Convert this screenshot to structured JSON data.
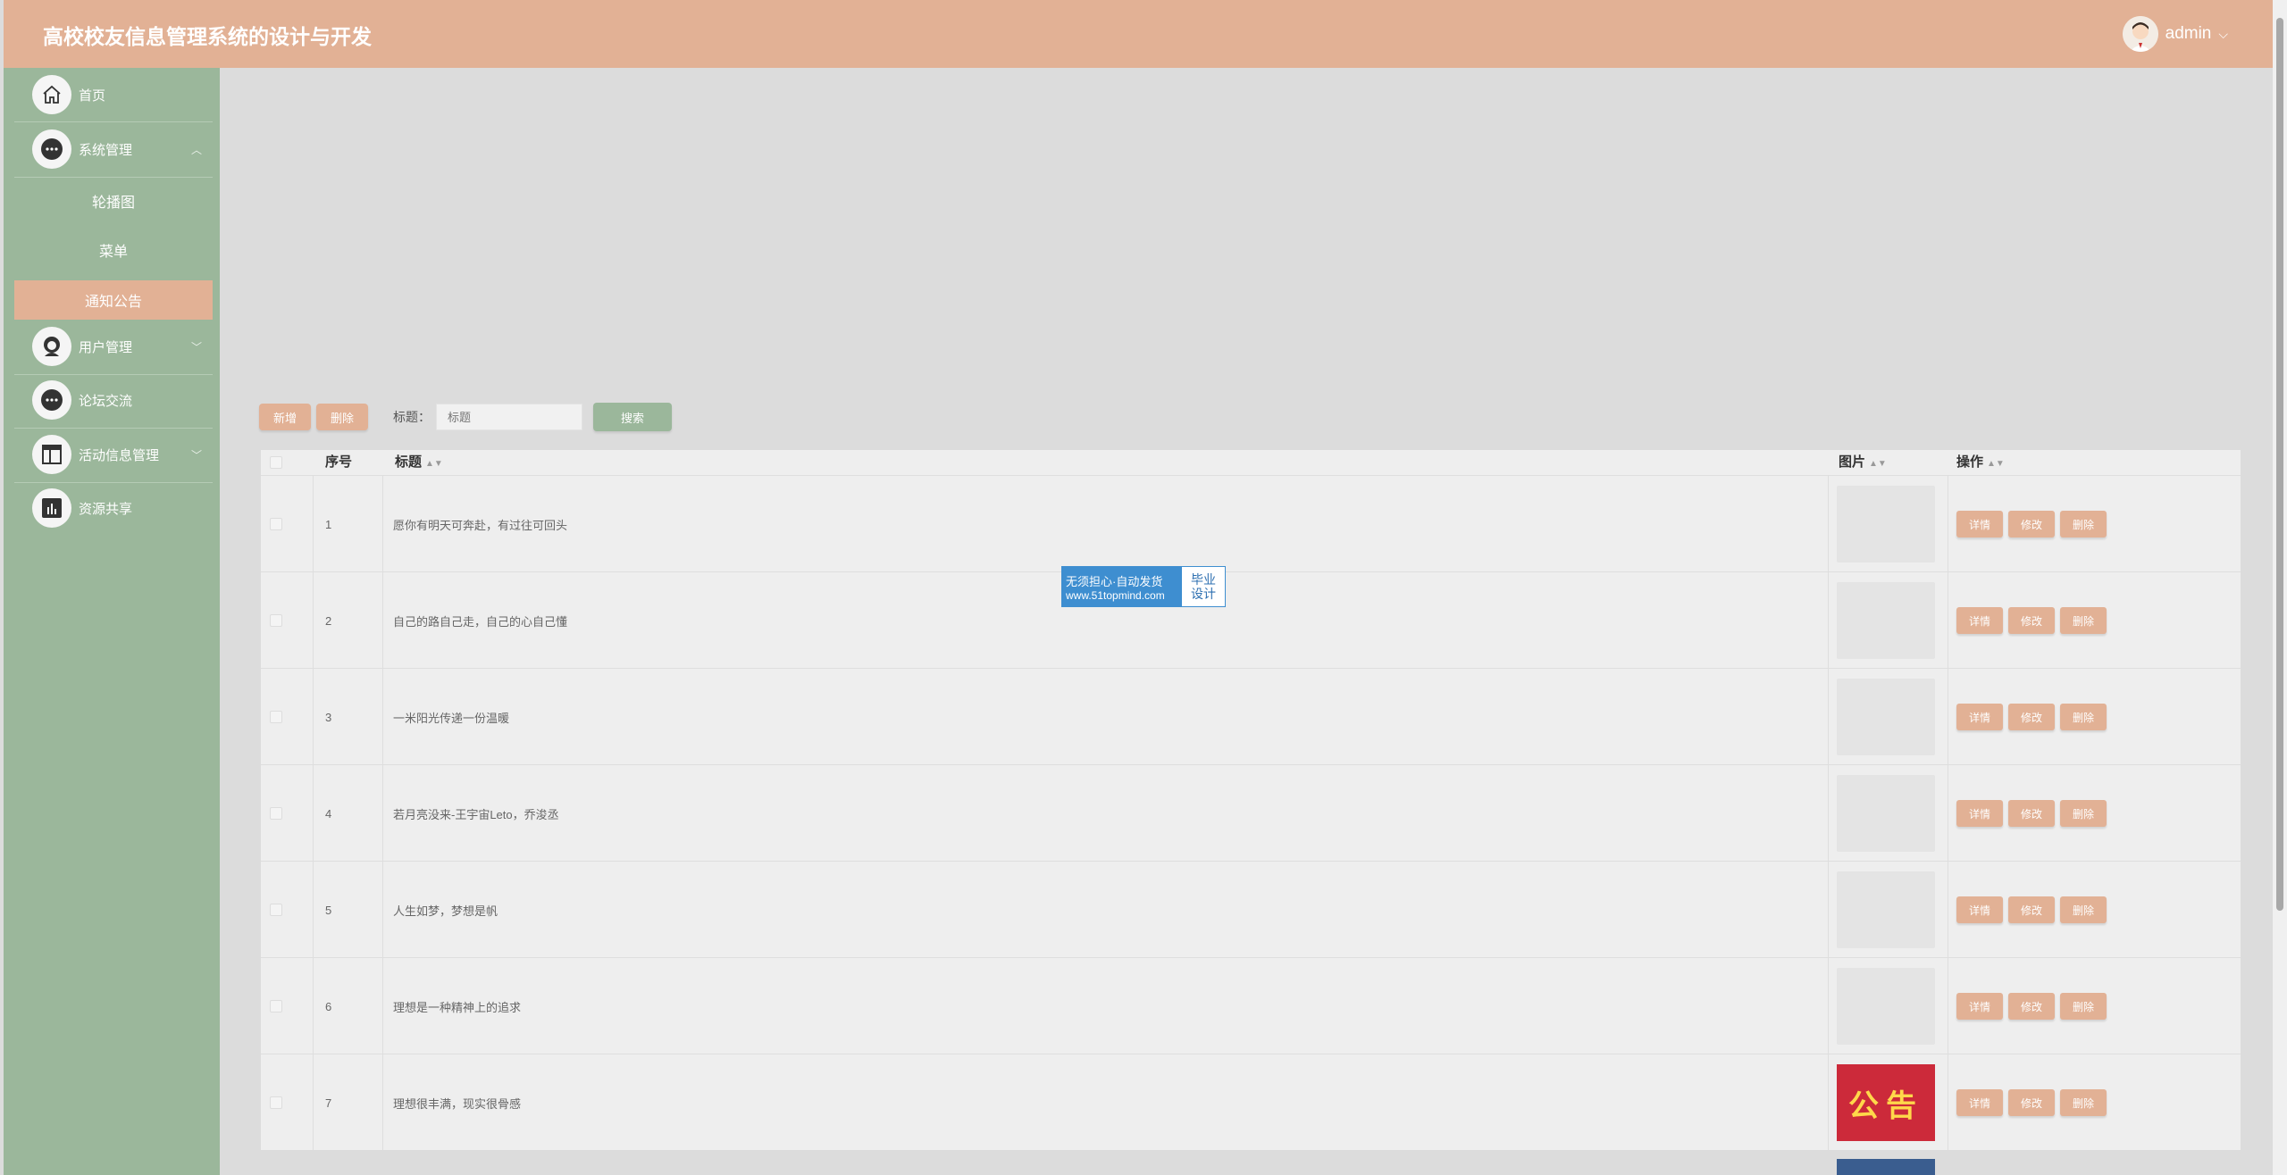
{
  "header": {
    "title": "高校校友信息管理系统的设计与开发",
    "user": "admin"
  },
  "sidebar": {
    "items": [
      {
        "label": "首页",
        "icon": "home-icon"
      },
      {
        "label": "系统管理",
        "icon": "more-icon",
        "expanded": true,
        "sub": [
          {
            "label": "轮播图"
          },
          {
            "label": "菜单"
          },
          {
            "label": "通知公告",
            "active": true
          }
        ]
      },
      {
        "label": "用户管理",
        "icon": "user-icon"
      },
      {
        "label": "论坛交流",
        "icon": "chat-icon"
      },
      {
        "label": "活动信息管理",
        "icon": "layout-icon"
      },
      {
        "label": "资源共享",
        "icon": "chart-icon"
      }
    ]
  },
  "toolbar": {
    "add": "新增",
    "delete": "删除",
    "filter_label": "标题：",
    "filter_placeholder": "标题",
    "search": "搜索"
  },
  "table": {
    "headers": {
      "index": "序号",
      "title": "标题",
      "image": "图片",
      "ops": "操作"
    },
    "op_labels": {
      "detail": "详情",
      "edit": "修改",
      "delete": "删除"
    },
    "rows": [
      {
        "index": "1",
        "title": "愿你有明天可奔赴，有过往可回头"
      },
      {
        "index": "2",
        "title": "自己的路自己走，自己的心自己懂"
      },
      {
        "index": "3",
        "title": "一米阳光传递一份温暖"
      },
      {
        "index": "4",
        "title": "若月亮没来-王宇宙Leto，乔浚丞"
      },
      {
        "index": "5",
        "title": "人生如梦，梦想是帆"
      },
      {
        "index": "6",
        "title": "理想是一种精神上的追求"
      },
      {
        "index": "7",
        "title": "理想很丰满，现实很骨感",
        "image_text": "公告"
      }
    ]
  },
  "watermark": {
    "line1": "无须担心·自动发货",
    "line2": "www.51topmind.com",
    "right1": "毕业",
    "right2": "设计"
  },
  "colors": {
    "header": "#e2b195",
    "sidebar": "#9bb79b",
    "accent": "#e2b195",
    "search": "#9bb79b"
  }
}
